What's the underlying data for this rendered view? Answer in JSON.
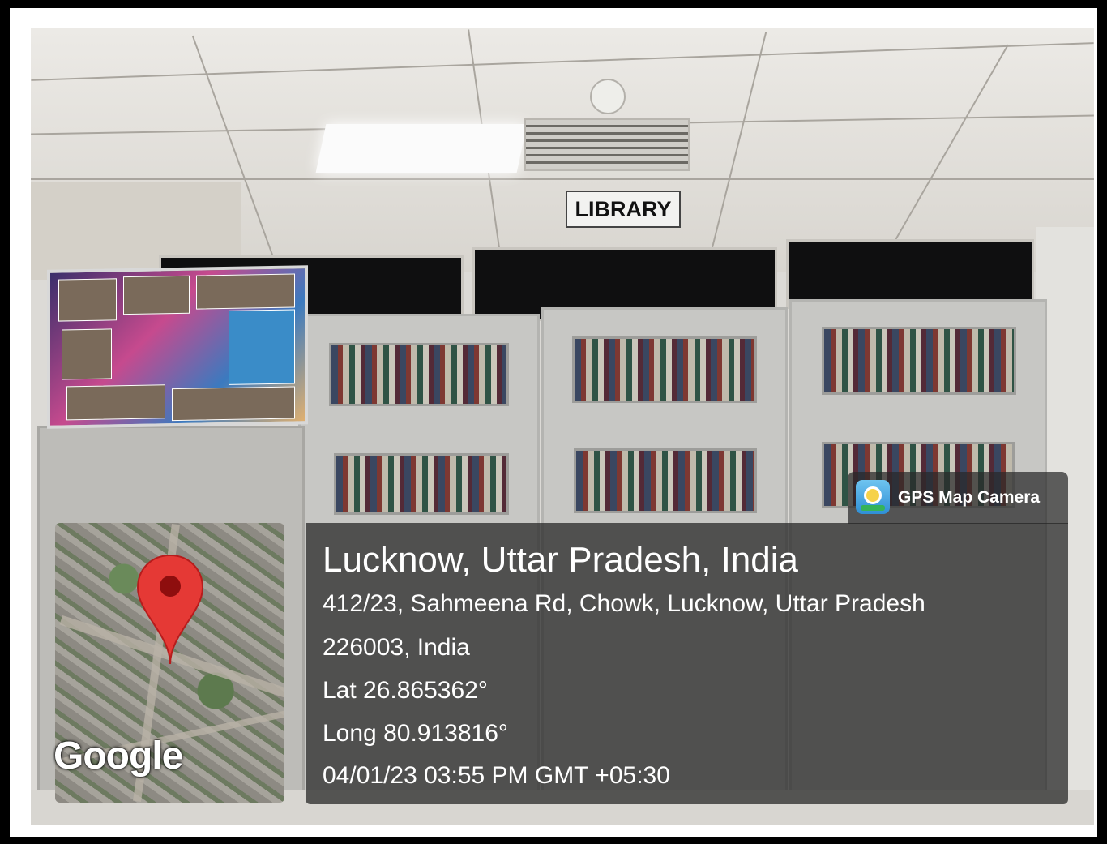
{
  "sign": {
    "text": "LIBRARY"
  },
  "map": {
    "brand": "Google",
    "pin_icon": "map-pin-icon",
    "pin_color": "#e53935"
  },
  "app": {
    "name": "GPS Map Camera",
    "icon": "gps-map-camera-icon"
  },
  "location": {
    "city": "Lucknow, Uttar Pradesh, India",
    "address_line1": "412/23, Sahmeena Rd, Chowk, Lucknow, Uttar Pradesh",
    "address_line2": "226003, India",
    "latitude": "Lat 26.865362°",
    "longitude": "Long 80.913816°",
    "timestamp": "04/01/23 03:55 PM GMT +05:30"
  },
  "colors": {
    "overlay": "#262626",
    "text": "#ffffff",
    "frame": "#000000"
  }
}
